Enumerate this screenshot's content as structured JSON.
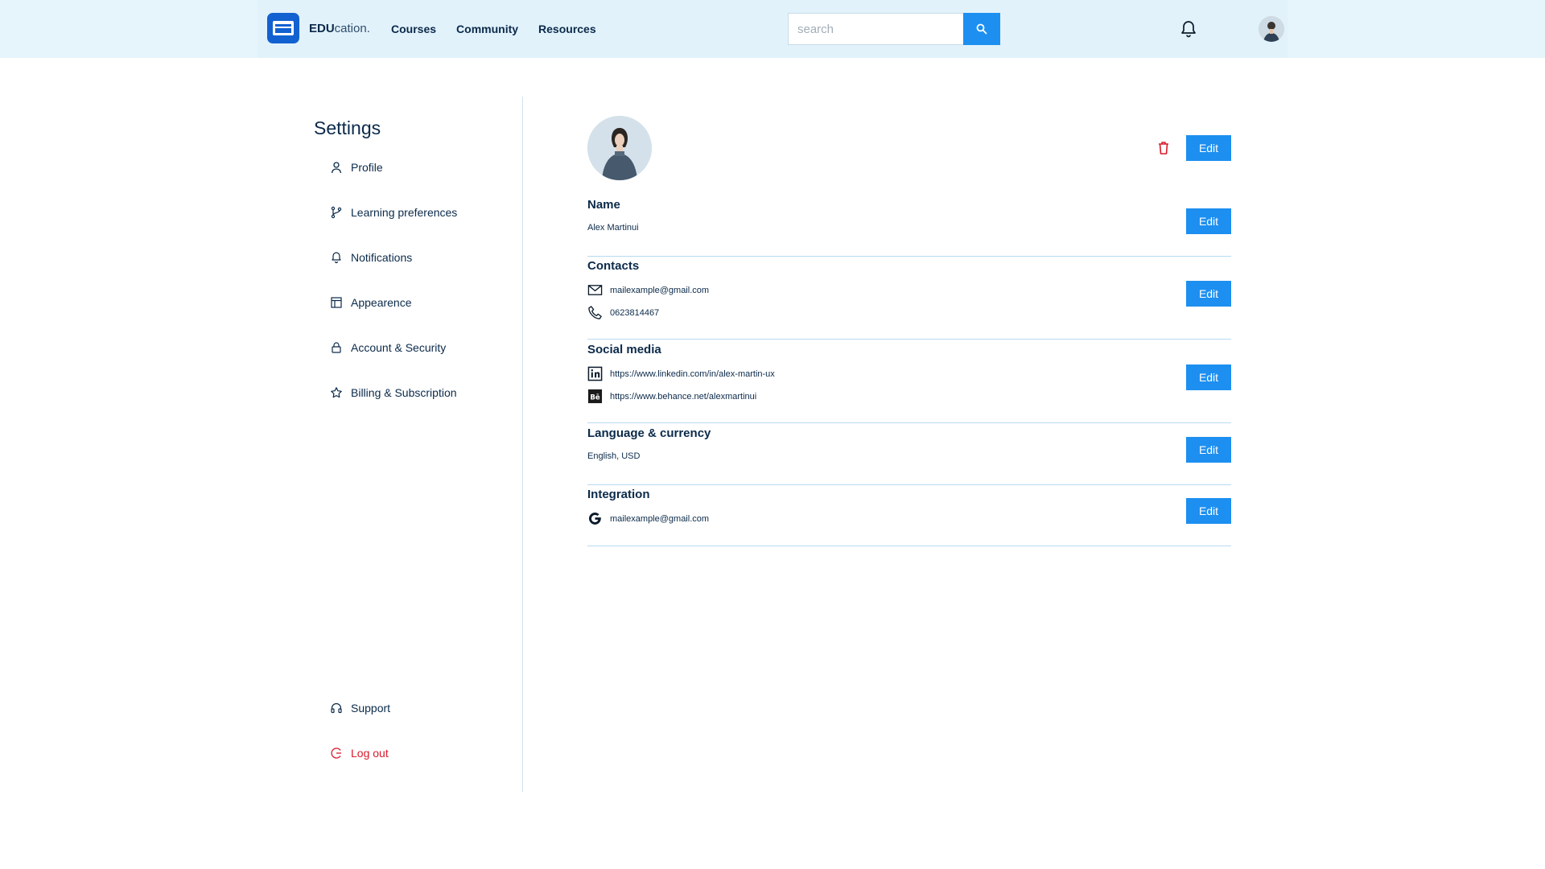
{
  "brand": {
    "bold": "EDU",
    "rest": "cation."
  },
  "nav": {
    "courses": "Courses",
    "community": "Community",
    "resources": "Resources"
  },
  "search": {
    "placeholder": "search"
  },
  "sidebar": {
    "title": "Settings",
    "items": [
      {
        "label": "Profile",
        "icon": "user-icon"
      },
      {
        "label": "Learning preferences",
        "icon": "branch-icon"
      },
      {
        "label": "Notifications",
        "icon": "bell-icon"
      },
      {
        "label": "Appearence",
        "icon": "layout-icon"
      },
      {
        "label": "Account & Security",
        "icon": "lock-icon"
      },
      {
        "label": "Billing & Subscription",
        "icon": "star-icon"
      }
    ],
    "support": "Support",
    "logout": "Log out"
  },
  "profile": {
    "edit_label": "Edit",
    "name": {
      "heading": "Name",
      "value": "Alex Martinui"
    },
    "contacts": {
      "heading": "Contacts",
      "email": "mailexample@gmail.com",
      "phone": "0623814467"
    },
    "social": {
      "heading": "Social media",
      "linkedin": "https://www.linkedin.com/in/alex-martin-ux",
      "behance": "https://www.behance.net/alexmartinui"
    },
    "language": {
      "heading": "Language & currency",
      "value": "English, USD"
    },
    "integration": {
      "heading": "Integration",
      "value": "mailexample@gmail.com"
    }
  },
  "colors": {
    "accent": "#1d8ff0",
    "brand": "#1261d1",
    "danger": "#d71a2a",
    "text": "#0b2a4a"
  }
}
